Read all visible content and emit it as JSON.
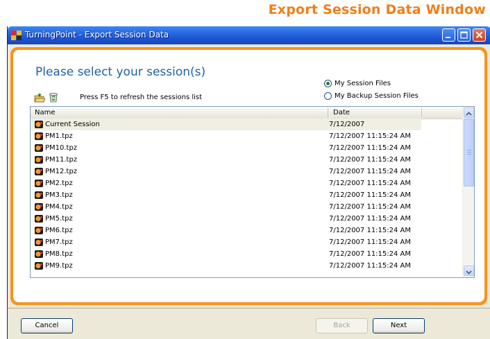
{
  "caption": "Export Session Data Window",
  "window": {
    "title": "TurningPoint - Export Session Data"
  },
  "heading": "Please select your session(s)",
  "source_options": [
    {
      "label": "My Session Files",
      "selected": true
    },
    {
      "label": "My Backup Session Files",
      "selected": false
    }
  ],
  "toolbar": {
    "open_icon": "open-folder-icon",
    "delete_icon": "recycle-bin-icon",
    "refresh_hint": "Press F5 to refresh the sessions list"
  },
  "list": {
    "columns": [
      "Name",
      "Date"
    ],
    "rows": [
      {
        "name": "Current Session",
        "date": "7/12/2007"
      },
      {
        "name": "PM1.tpz",
        "date": "7/12/2007 11:15:24 AM"
      },
      {
        "name": "PM10.tpz",
        "date": "7/12/2007 11:15:24 AM"
      },
      {
        "name": "PM11.tpz",
        "date": "7/12/2007 11:15:24 AM"
      },
      {
        "name": "PM12.tpz",
        "date": "7/12/2007 11:15:24 AM"
      },
      {
        "name": "PM2.tpz",
        "date": "7/12/2007 11:15:24 AM"
      },
      {
        "name": "PM3.tpz",
        "date": "7/12/2007 11:15:24 AM"
      },
      {
        "name": "PM4.tpz",
        "date": "7/12/2007 11:15:24 AM"
      },
      {
        "name": "PM5.tpz",
        "date": "7/12/2007 11:15:24 AM"
      },
      {
        "name": "PM6.tpz",
        "date": "7/12/2007 11:15:24 AM"
      },
      {
        "name": "PM7.tpz",
        "date": "7/12/2007 11:15:24 AM"
      },
      {
        "name": "PM8.tpz",
        "date": "7/12/2007 11:15:24 AM"
      },
      {
        "name": "PM9.tpz",
        "date": "7/12/2007 11:15:24 AM"
      }
    ]
  },
  "buttons": {
    "cancel": "Cancel",
    "back": "Back",
    "next": "Next"
  },
  "colors": {
    "caption": "#f07e1a",
    "panel_border": "#f7931e",
    "heading": "#1f5fa6",
    "titlebar": "#2766e0"
  }
}
